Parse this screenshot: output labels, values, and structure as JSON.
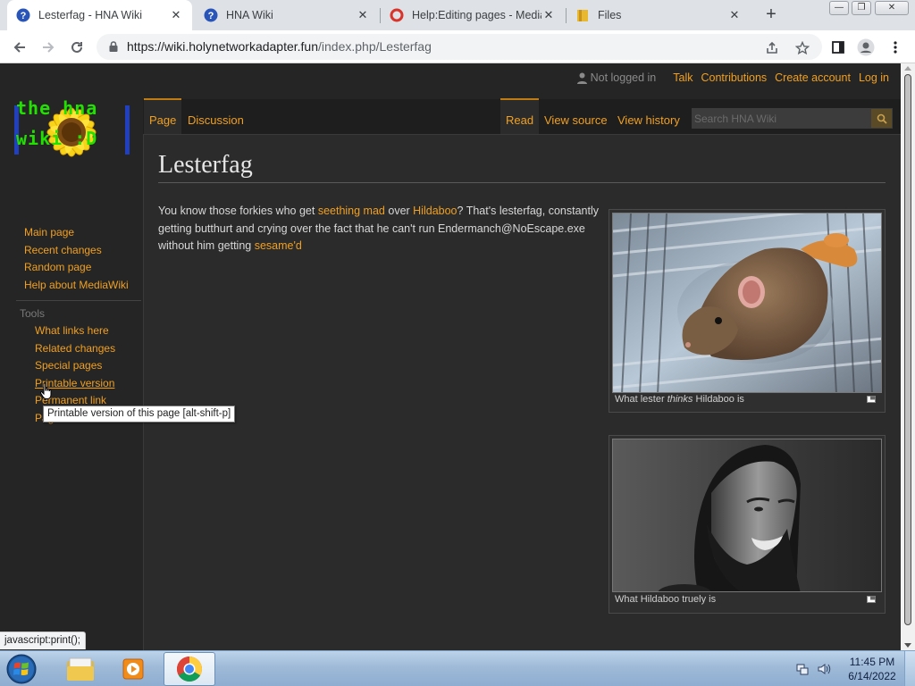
{
  "browser": {
    "tabs": [
      {
        "title": "Lesterfag - HNA Wiki",
        "icon": "wiki-question-icon",
        "active": true
      },
      {
        "title": "HNA Wiki",
        "icon": "wiki-question-icon",
        "active": false
      },
      {
        "title": "Help:Editing pages - Media",
        "icon": "mediawiki-ring-icon",
        "active": false
      },
      {
        "title": "Files",
        "icon": "folder-icon",
        "active": false
      }
    ],
    "close_glyph": "✕",
    "new_tab_glyph": "+",
    "window_controls": [
      "—",
      "❐",
      "✕"
    ],
    "url_host": "https://wiki.holynetworkadapter.fun",
    "url_path": "/index.php/Lesterfag"
  },
  "wiki": {
    "logo_lines": [
      "the hna",
      "wiki :D"
    ],
    "personal": {
      "not_logged_in": "Not logged in",
      "links": [
        "Talk",
        "Contributions",
        "Create account",
        "Log in"
      ]
    },
    "left_tabs": [
      "Page",
      "Discussion"
    ],
    "right_tabs": [
      "Read",
      "View source",
      "View history"
    ],
    "search_placeholder": "Search HNA Wiki",
    "navigation": [
      "Main page",
      "Recent changes",
      "Random page",
      "Help about MediaWiki"
    ],
    "tools_heading": "Tools",
    "tools": [
      "What links here",
      "Related changes",
      "Special pages",
      "Printable version",
      "Permanent link",
      "Page information"
    ],
    "title": "Lesterfag",
    "body": {
      "t1": "You know those forkies who get ",
      "l1": "seething mad",
      "t2": " over ",
      "l2": "Hildaboo",
      "t3": "? That's lesterfag, constantly getting butthurt and crying over the fact that he can't run Endermanch@NoEscape.exe without him getting ",
      "l3": "sesame'd"
    },
    "thumbs": [
      {
        "caption_pre": "What lester ",
        "caption_em": "thinks",
        "caption_post": " Hildaboo is"
      },
      {
        "caption_pre": "What Hildaboo truely is",
        "caption_em": "",
        "caption_post": ""
      }
    ],
    "tooltip": "Printable version of this page [alt-shift-p]"
  },
  "statusbar": "javascript:print();",
  "taskbar": {
    "time": "11:45 PM",
    "date": "6/14/2022"
  },
  "colors": {
    "link": "#f0a020",
    "background": "#252525",
    "content": "#2b2b2b"
  }
}
